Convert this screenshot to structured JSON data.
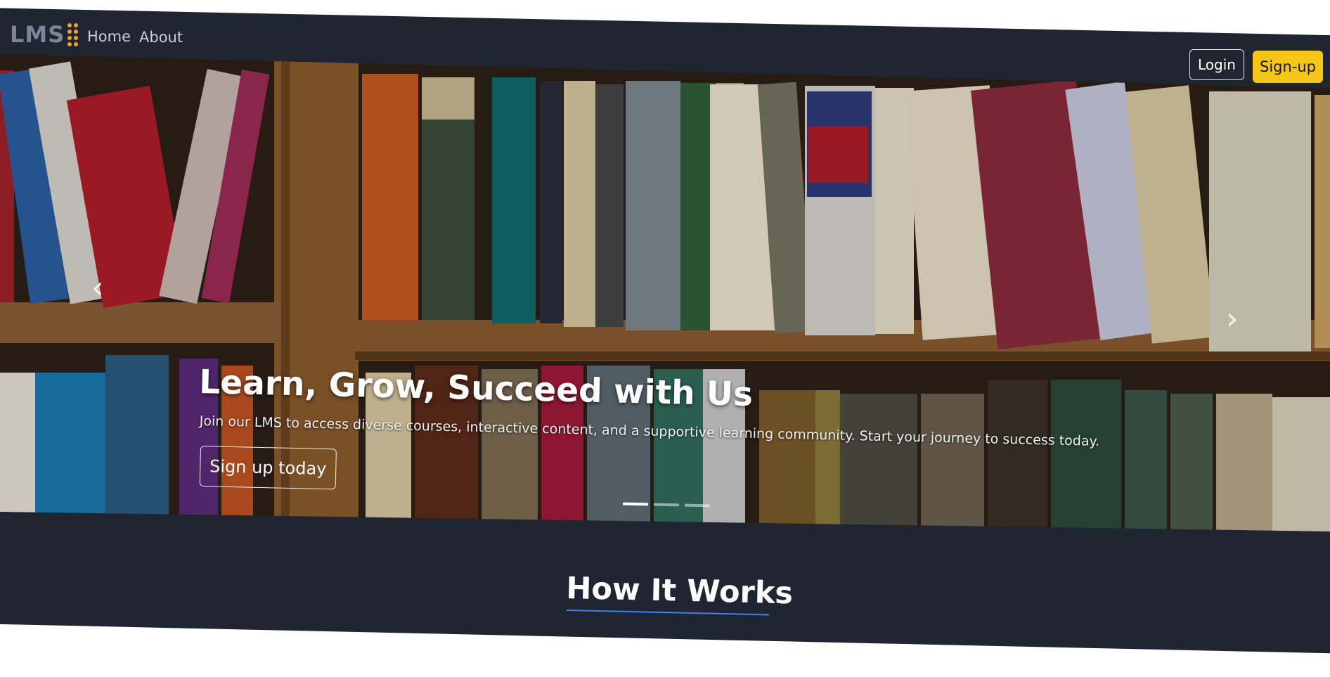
{
  "navbar": {
    "brand": "LMS",
    "links": [
      "Home",
      "About"
    ],
    "login_label": "Login",
    "signup_label": "Sign-up"
  },
  "hero": {
    "title": "Learn, Grow, Succeed with Us",
    "subtitle": "Join our LMS to access diverse courses, interactive content, and a supportive learning community. Start your journey to success today.",
    "cta_label": "Sign up today",
    "prev_glyph": "‹",
    "next_glyph": "›",
    "slides_total": 3,
    "active_slide": 1
  },
  "section": {
    "title": "How It Works"
  },
  "colors": {
    "page_bg": "#1f2632",
    "accent_yellow": "#f5c518",
    "underline_blue": "#3b82f6",
    "brand_dots": "#f0a030"
  }
}
